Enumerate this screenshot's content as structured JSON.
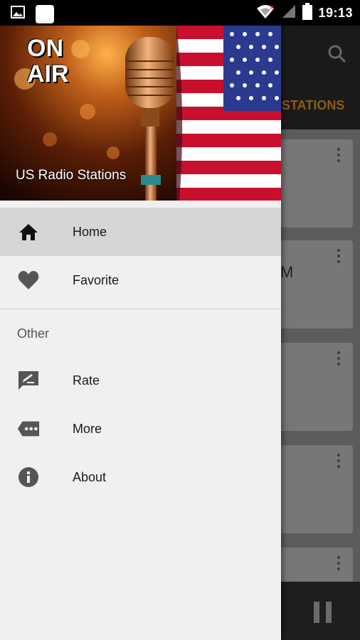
{
  "status_bar": {
    "time": "19:13",
    "left_icons": [
      "image-icon",
      "square-notification-icon"
    ],
    "right_icons": [
      "wifi-icon",
      "signal-icon",
      "battery-icon"
    ]
  },
  "background_app": {
    "tab_label_partial": "STATIONS",
    "card_text_partial": "M",
    "accent_color": "#8a5a1c"
  },
  "drawer": {
    "header": {
      "on_air_line1": "ON",
      "on_air_line2": "AIR",
      "title": "US Radio Stations"
    },
    "primary_items": [
      {
        "label": "Home",
        "icon": "home-icon",
        "active": true
      },
      {
        "label": "Favorite",
        "icon": "heart-icon",
        "active": false
      }
    ],
    "section_title": "Other",
    "secondary_items": [
      {
        "label": "Rate",
        "icon": "rate-icon"
      },
      {
        "label": "More",
        "icon": "more-icon"
      },
      {
        "label": "About",
        "icon": "info-icon"
      }
    ]
  }
}
